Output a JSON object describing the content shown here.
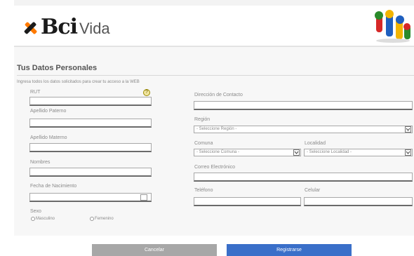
{
  "brand": {
    "name": "Bci",
    "product": "Vida"
  },
  "section": {
    "title": "Tus Datos Personales",
    "instructions": "Ingresa todos los datos solicitados para crear tu acceso a la WEB"
  },
  "form": {
    "rut": {
      "label": "RUT",
      "value": ""
    },
    "help_icon": "?",
    "apellido_paterno": {
      "label": "Apellido Paterno",
      "value": ""
    },
    "apellido_materno": {
      "label": "Apellido Materno",
      "value": ""
    },
    "nombres": {
      "label": "Nombres",
      "value": ""
    },
    "fecha_nacimiento": {
      "label": "Fecha de Nacimiento",
      "value": ""
    },
    "sexo": {
      "label": "Sexo",
      "options": [
        "Masculino",
        "Femenino"
      ]
    },
    "direccion": {
      "label": "Dirección de Contacto",
      "value": ""
    },
    "region": {
      "label": "Región",
      "selected": "- Seleccione Región -"
    },
    "comuna": {
      "label": "Comuna",
      "selected": "- Seleccione Comuna -"
    },
    "localidad": {
      "label": "Localidad",
      "selected": "- Seleccione Localidad -"
    },
    "correo": {
      "label": "Correo Electrónico",
      "value": ""
    },
    "telefono": {
      "label": "Teléfono",
      "value": ""
    },
    "celular": {
      "label": "Celular",
      "value": ""
    }
  },
  "actions": {
    "cancel_label": "Cancelar",
    "register_label": "Registrarse"
  },
  "colors": {
    "accent_blue": "#3a6fc9",
    "cancel_gray": "#a7a7a7",
    "logo_orange": "#ff7a00"
  },
  "icons": [
    "bci-logo-icon",
    "mascot-icon",
    "help-icon",
    "calendar-icon",
    "chevron-down-icon"
  ]
}
